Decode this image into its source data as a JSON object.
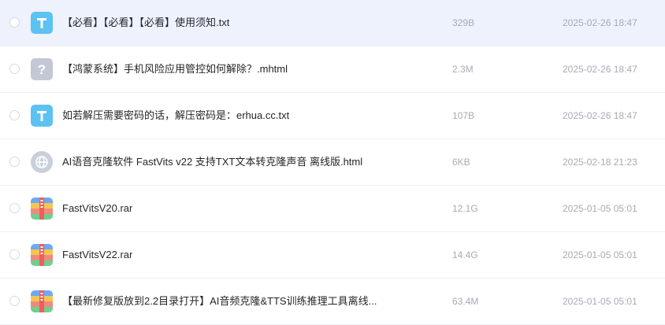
{
  "file_list": {
    "rows": [
      {
        "icon": "text-file-icon",
        "name": "【必看】【必看】【必看】使用须知.txt",
        "size": "329B",
        "date": "2025-02-26 18:47",
        "selected": true
      },
      {
        "icon": "unknown-file-icon",
        "name": "【鸿蒙系统】手机风险应用管控如何解除？.mhtml",
        "size": "2.3M",
        "date": "2025-02-26 18:47",
        "selected": false
      },
      {
        "icon": "text-file-icon",
        "name": "如若解压需要密码的话，解压密码是：erhua.cc.txt",
        "size": "107B",
        "date": "2025-02-26 18:47",
        "selected": false
      },
      {
        "icon": "web-file-icon",
        "name": "AI语音克隆软件 FastVits v22 支持TXT文本转克隆声音 离线版.html",
        "size": "6KB",
        "date": "2025-02-18 21:23",
        "selected": false
      },
      {
        "icon": "archive-file-icon",
        "name": "FastVitsV20.rar",
        "size": "12.1G",
        "date": "2025-01-05 05:01",
        "selected": false
      },
      {
        "icon": "archive-file-icon",
        "name": "FastVitsV22.rar",
        "size": "14.4G",
        "date": "2025-01-05 05:01",
        "selected": false
      },
      {
        "icon": "archive-file-icon",
        "name": "【最新修复版放到2.2目录打开】AI音频克隆&TTS训练推理工具离线...",
        "size": "63.4M",
        "date": "2025-01-05 05:01",
        "selected": false
      }
    ]
  }
}
